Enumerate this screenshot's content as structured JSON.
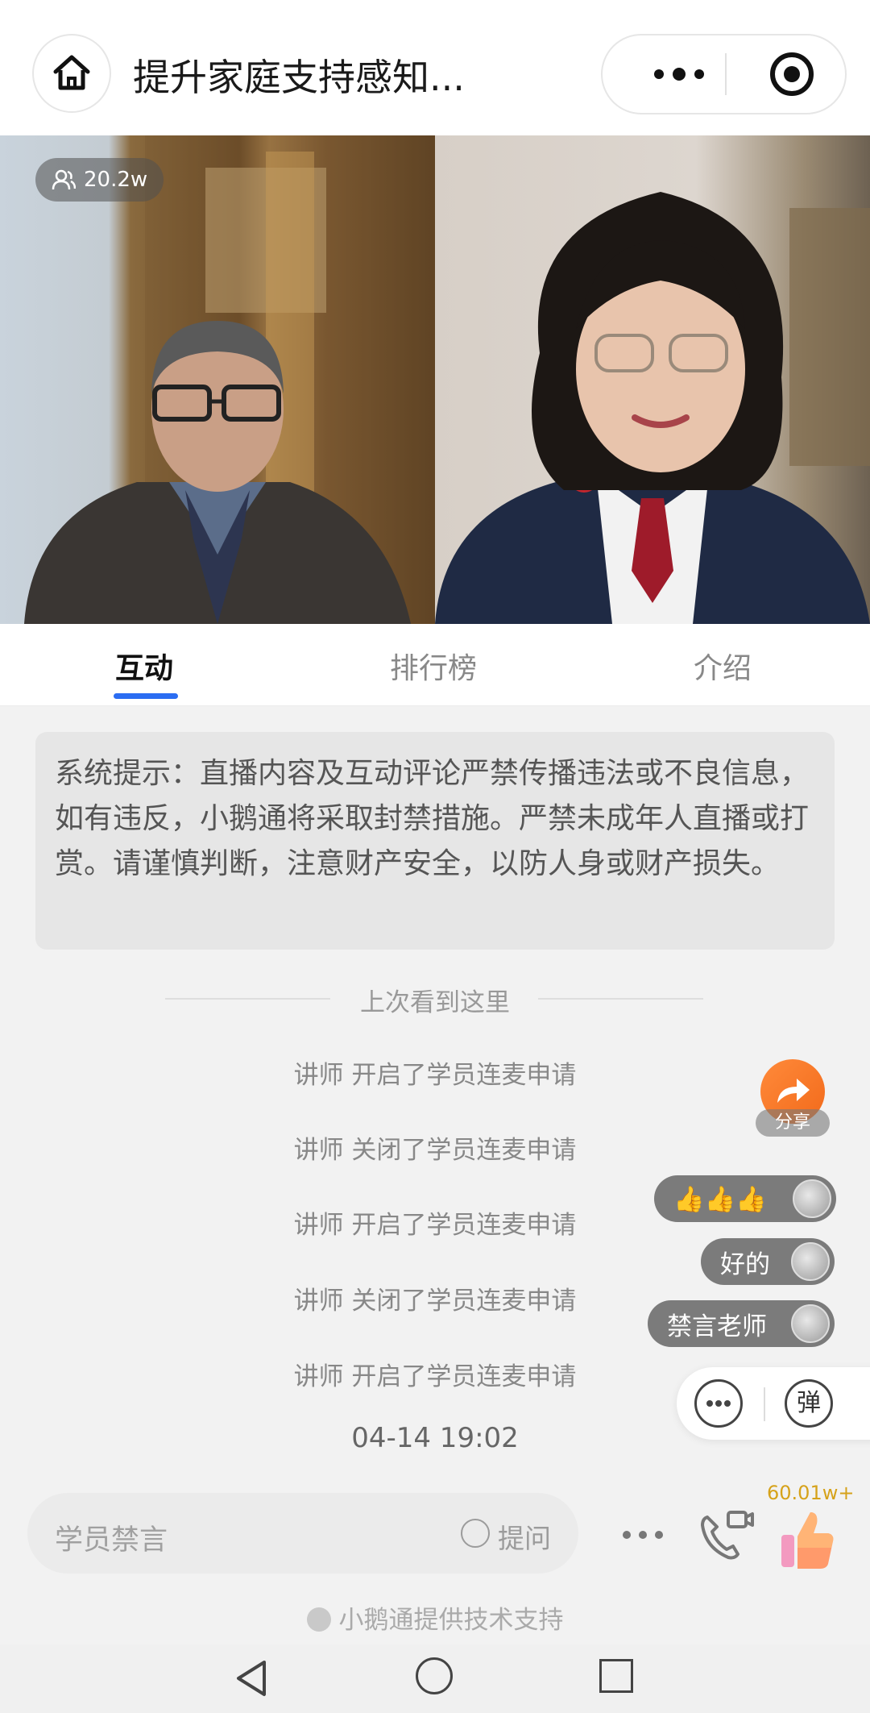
{
  "header": {
    "title": "提升家庭支持感知...",
    "home_icon": "home-icon",
    "more_icon": "more-dots-icon",
    "close_icon": "target-icon"
  },
  "video": {
    "viewer_count": "20.2w"
  },
  "tabs": [
    {
      "label": "互动",
      "active": true
    },
    {
      "label": "排行榜",
      "active": false
    },
    {
      "label": "介绍",
      "active": false
    }
  ],
  "notice": {
    "text": "系统提示：直播内容及互动评论严禁传播违法或不良信息，如有违反，小鹅通将采取封禁措施。严禁未成年人直播或打赏。请谨慎判断，注意财产安全，以防人身或财产损失。"
  },
  "divider_text": "上次看到这里",
  "system_messages": [
    "讲师 开启了学员连麦申请",
    "讲师 关闭了学员连麦申请",
    "讲师 开启了学员连麦申请",
    "讲师 关闭了学员连麦申请",
    "讲师 开启了学员连麦申请"
  ],
  "timestamp": "04-14 19:02",
  "share": {
    "label": "分享"
  },
  "danmaku": [
    {
      "text": "👍👍👍"
    },
    {
      "text": "好的"
    },
    {
      "text": "禁言老师"
    }
  ],
  "float_panel": {
    "dan_label": "弹"
  },
  "bottom": {
    "input_placeholder": "学员禁言",
    "question_label": "提问",
    "like_count": "60.01w+",
    "powered_by": "小鹅通提供技术支持"
  },
  "colors": {
    "accent": "#2b6df2",
    "share_orange": "#f26a1b",
    "like_gold": "#d6a21a"
  }
}
